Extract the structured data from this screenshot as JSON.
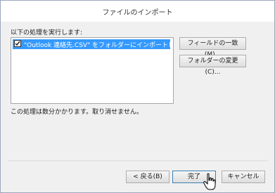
{
  "dialog": {
    "title": "ファイルのインポート"
  },
  "actions": {
    "prompt": "以下の処理を実行します:",
    "items": [
      {
        "label": "\"Outlook 連絡先.CSV\" をフォルダーにインポートします...",
        "checked": true,
        "selected": true
      }
    ]
  },
  "side_buttons": {
    "map_fields": "フィールドの一致(M)...",
    "change_folder": "フォルダーの変更(C)..."
  },
  "note": "この処理は数分かかります。取り消せません。",
  "footer": {
    "back": "< 戻る(B)",
    "finish": "完了",
    "cancel": "キャンセル"
  },
  "colors": {
    "selection": "#3399ff",
    "dialog_bg": "#f0f0f0"
  }
}
